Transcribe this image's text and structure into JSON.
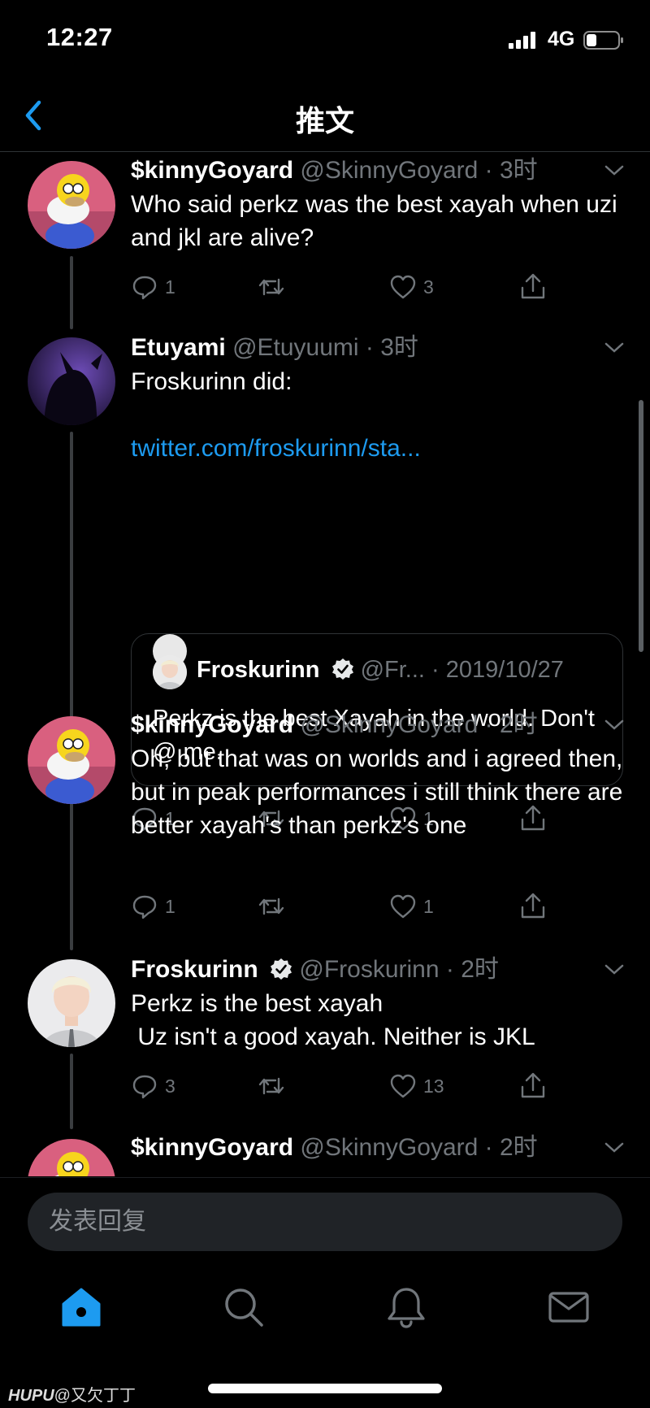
{
  "status": {
    "time": "12:27",
    "network": "4G"
  },
  "nav": {
    "title": "推文"
  },
  "tweets": [
    {
      "name": "$kinnyGoyard",
      "handle": "@SkinnyGoyard",
      "dot": " · ",
      "time": "3时",
      "text": "Who said perkz was the best xayah when uzi and jkl are alive?",
      "replies": "1",
      "likes": "3"
    },
    {
      "name": "Etuyami",
      "handle": "@Etuyuumi",
      "dot": " · ",
      "time": "3时",
      "text": "Froskurinn did:",
      "link": "twitter.com/froskurinn/sta...",
      "quote": {
        "name": "Froskurinn",
        "handle": "@Fr...",
        "dot": " · ",
        "date": "2019/10/27",
        "text": "Perkz is the best Xayah in the world. Don't @ me."
      },
      "replies": "1",
      "likes": "1"
    },
    {
      "name": "$kinnyGoyard",
      "handle": "@SkinnyGoyard",
      "dot": " · ",
      "time": "2时",
      "text": "Oh, but that was on worlds and i agreed then, but in peak performances i still think there are better xayah's than perkz's one",
      "replies": "1",
      "likes": "1"
    },
    {
      "name": "Froskurinn",
      "handle": "@Froskurinn",
      "dot": " · ",
      "time": "2时",
      "text_line1": "Perkz is the best xayah",
      "text_line2": " Uz isn't a good xayah. Neither is JKL",
      "replies": "3",
      "likes": "13"
    },
    {
      "name": "$kinnyGoyard",
      "handle": "@SkinnyGoyard",
      "dot": " · ",
      "time": "2时"
    }
  ],
  "reply": {
    "placeholder": "发表回复"
  },
  "watermark": {
    "brand": "HUPU",
    "user": "@又欠丁丁"
  },
  "icons": [
    "back-chevron",
    "reply-icon",
    "retweet-icon",
    "like-icon",
    "share-icon",
    "verified-badge",
    "home-icon",
    "search-icon",
    "bell-icon",
    "mail-icon"
  ],
  "colors": {
    "accent": "#1d9bf0",
    "muted": "#71767b",
    "background": "#000000"
  }
}
